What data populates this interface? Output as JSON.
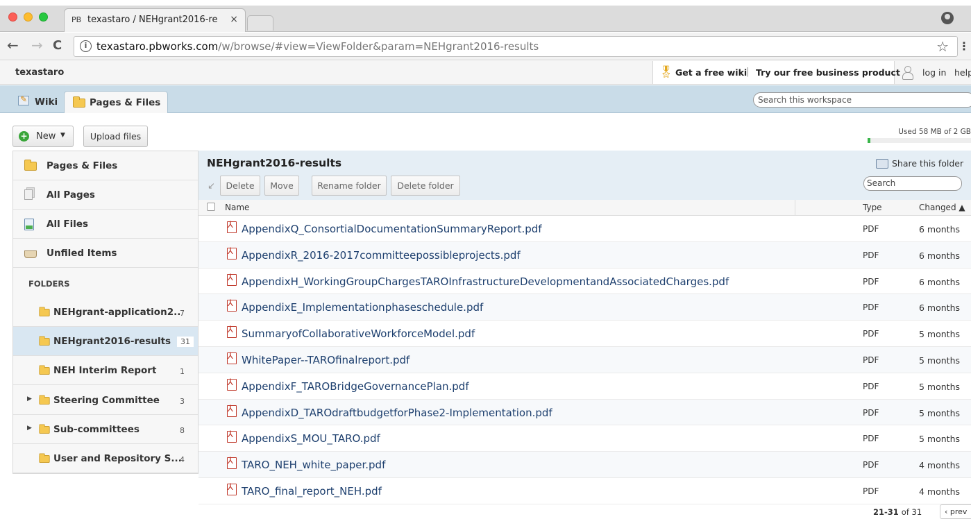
{
  "browser": {
    "tab_favicon": "PB",
    "tab_title": "texastaro / NEHgrant2016-re",
    "tab_close": "×",
    "url_host": "texastaro.pbworks.com",
    "url_path": "/w/browse/#view=ViewFolder&param=NEHgrant2016-results",
    "back": "←",
    "forward": "→",
    "reload": "C",
    "info": "i",
    "star": "☆",
    "menu": "⋮"
  },
  "site": {
    "name": "texastaro",
    "promo_free_wiki": "Get a free wiki",
    "promo_separator": "|",
    "promo_business": "Try our free business product",
    "login": "log in",
    "help": "help"
  },
  "workspace_tabs": {
    "wiki": "Wiki",
    "pages_files": "Pages & Files",
    "search_placeholder": "Search this workspace"
  },
  "toolbar": {
    "new_label": "New",
    "new_plus": "+",
    "new_caret": "▼",
    "upload_label": "Upload files",
    "quota_text": "Used 58 MB of 2 GB",
    "quota_fraction": 0.03
  },
  "sidebar": {
    "items": [
      {
        "label": "Pages & Files"
      },
      {
        "label": "All Pages"
      },
      {
        "label": "All Files"
      },
      {
        "label": "Unfiled Items"
      }
    ],
    "folders_heading": "FOLDERS",
    "folders": [
      {
        "label": "NEHgrant-application2..",
        "count": "7",
        "expandable": false,
        "active": false
      },
      {
        "label": "NEHgrant2016-results",
        "count": "31",
        "expandable": false,
        "active": true
      },
      {
        "label": "NEH Interim Report",
        "count": "1",
        "expandable": false,
        "active": false
      },
      {
        "label": "Steering Committee",
        "count": "3",
        "expandable": true,
        "active": false
      },
      {
        "label": "Sub-committees",
        "count": "8",
        "expandable": true,
        "active": false
      },
      {
        "label": "User and Repository S...",
        "count": "4",
        "expandable": false,
        "active": false
      }
    ],
    "expand_glyph": "▶"
  },
  "main": {
    "folder_title": "NEHgrant2016-results",
    "share_label": "Share this folder",
    "actions": {
      "undo": "↙",
      "delete": "Delete",
      "move": "Move",
      "rename": "Rename folder",
      "delete_folder": "Delete folder"
    },
    "search_placeholder": "Search",
    "columns": {
      "name": "Name",
      "type": "Type",
      "changed": "Changed ▲"
    },
    "files": [
      {
        "name": "AppendixQ_ConsortialDocumentationSummaryReport.pdf",
        "type": "PDF",
        "changed": "6 months"
      },
      {
        "name": "AppendixR_2016-2017committeepossibleprojects.pdf",
        "type": "PDF",
        "changed": "6 months"
      },
      {
        "name": "AppendixH_WorkingGroupChargesTAROInfrastructureDevelopmentandAssociatedCharges.pdf",
        "type": "PDF",
        "changed": "6 months"
      },
      {
        "name": "AppendixE_Implementationphaseschedule.pdf",
        "type": "PDF",
        "changed": "6 months"
      },
      {
        "name": "SummaryofCollaborativeWorkforceModel.pdf",
        "type": "PDF",
        "changed": "5 months"
      },
      {
        "name": "WhitePaper--TAROfinalreport.pdf",
        "type": "PDF",
        "changed": "5 months"
      },
      {
        "name": "AppendixF_TAROBridgeGovernancePlan.pdf",
        "type": "PDF",
        "changed": "5 months"
      },
      {
        "name": "AppendixD_TAROdraftbudgetforPhase2-Implementation.pdf",
        "type": "PDF",
        "changed": "5 months"
      },
      {
        "name": "AppendixS_MOU_TARO.pdf",
        "type": "PDF",
        "changed": "5 months"
      },
      {
        "name": "TARO_NEH_white_paper.pdf",
        "type": "PDF",
        "changed": "4 months"
      },
      {
        "name": "TARO_final_report_NEH.pdf",
        "type": "PDF",
        "changed": "4 months"
      }
    ],
    "pager_range": "21-31",
    "pager_of": "of 31",
    "prev_label": "‹ prev"
  }
}
